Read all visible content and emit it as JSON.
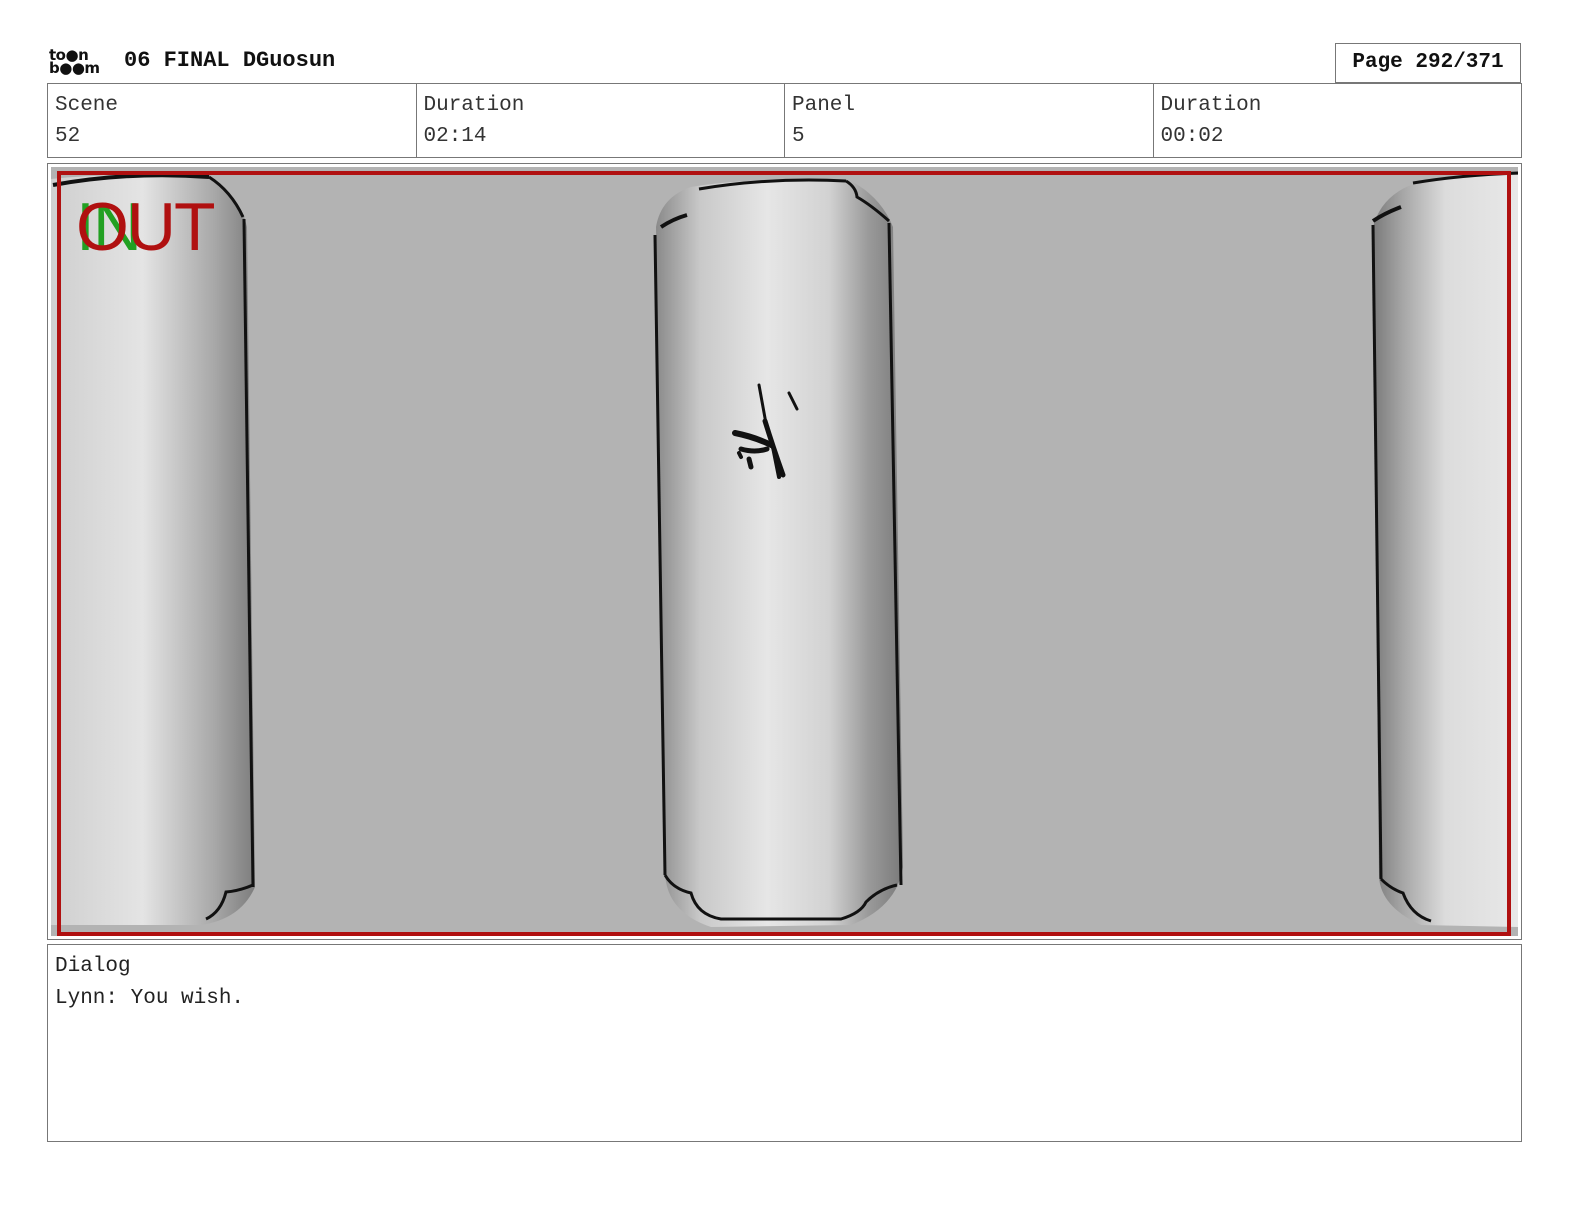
{
  "header": {
    "logo_top": "to●n",
    "logo_bottom": "b●●m",
    "title": "06 FINAL DGuosun",
    "page": "Page 292/371"
  },
  "info": {
    "scene_label": "Scene",
    "scene_value": "52",
    "duration_label": "Duration",
    "duration_value": "02:14",
    "panel_label": "Panel",
    "panel_value": "5",
    "panel_duration_label": "Duration",
    "panel_duration_value": "00:02"
  },
  "panel": {
    "in_label": "IN",
    "out_label": "OUT",
    "frame_color": "#b01010",
    "in_color": "#22a022",
    "background_color": "#b3b3b3"
  },
  "dialog": {
    "label": "Dialog",
    "text": "Lynn: You wish."
  }
}
